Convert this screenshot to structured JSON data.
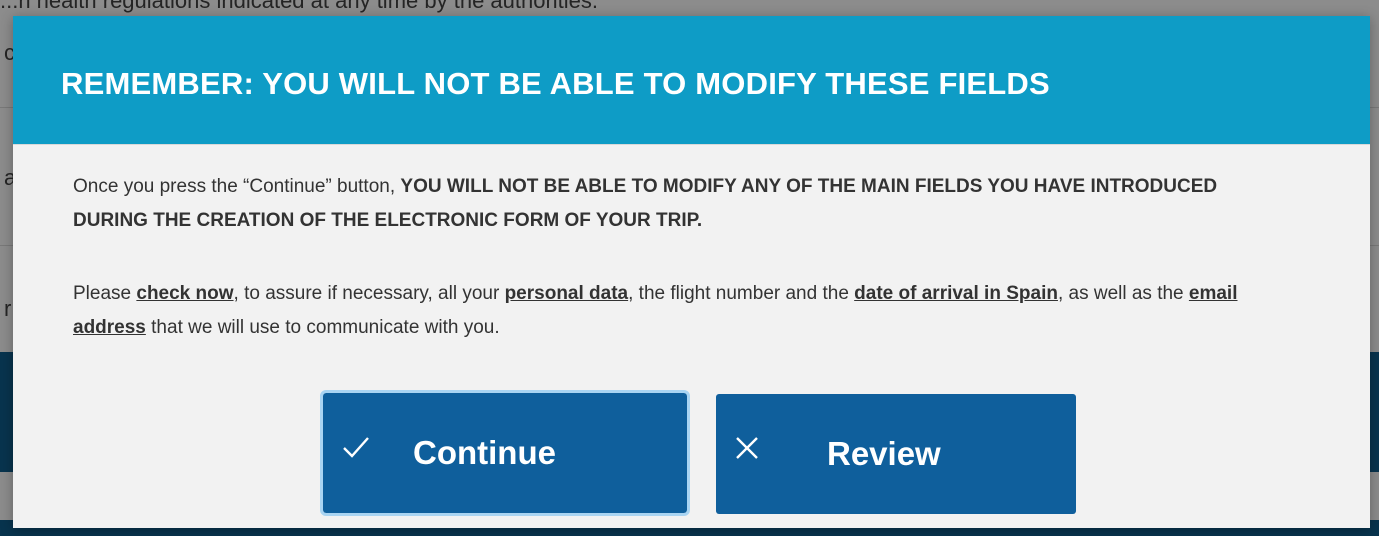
{
  "background": {
    "top_text": "...h health regulations indicated at any time by the authorities.",
    "left_letters": [
      "c",
      "a",
      "r"
    ]
  },
  "modal": {
    "title": "REMEMBER: YOU WILL NOT BE ABLE TO MODIFY THESE FIELDS",
    "paragraph1": {
      "intro": "Once you press the “Continue” button, ",
      "bold": "YOU WILL NOT BE ABLE TO MODIFY ANY OF THE MAIN FIELDS YOU HAVE INTRODUCED DURING THE CREATION OF THE ELECTRONIC FORM OF YOUR TRIP."
    },
    "paragraph2": {
      "t1": "Please ",
      "u1": "check now",
      "t2": ", to assure if necessary, all your ",
      "u2": "personal data",
      "t3": ", the flight number and the ",
      "u3": "date of arrival in Spain",
      "t4": ", as well as the ",
      "u4": "email address",
      "t5": " that we will use to communicate with you."
    },
    "buttons": {
      "continue_label": "Continue",
      "continue_icon": "check-icon",
      "review_label": "Review",
      "review_icon": "close-icon"
    }
  },
  "colors": {
    "header": "#0e9cc6",
    "button": "#0f5f9c",
    "body": "#f2f2f2"
  }
}
